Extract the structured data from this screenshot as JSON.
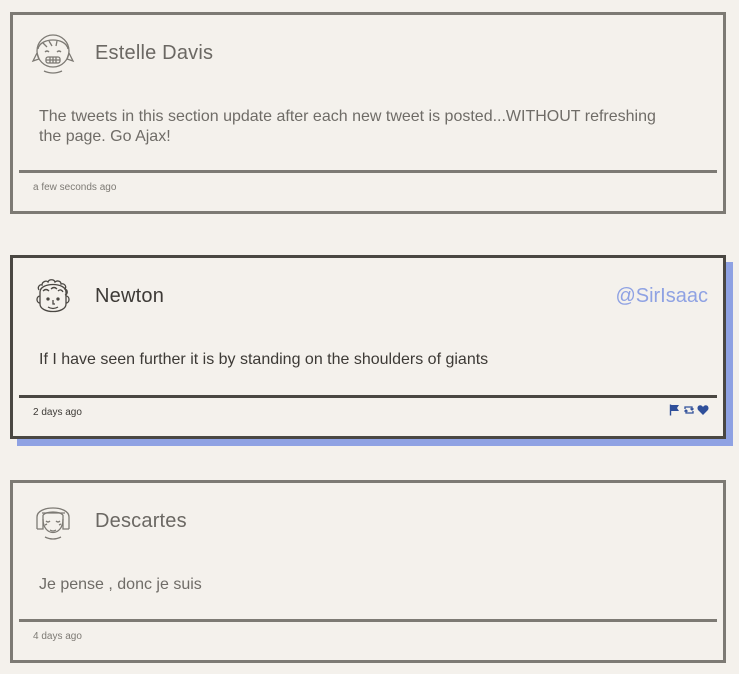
{
  "tweets": [
    {
      "user": "Estelle Davis",
      "handle": "",
      "content": "The tweets in this section update after each new tweet is posted...WITHOUT refreshing the page. Go Ajax!",
      "time": "a few seconds ago",
      "avatar_icon": "girl-pigtails-avatar-icon"
    },
    {
      "user": "Newton",
      "handle": "@SirIsaac",
      "content": "If I have seen further it is by standing on the shoulders of giants",
      "time": "2 days ago",
      "avatar_icon": "curly-hair-man-avatar-icon",
      "actions": [
        "flag-icon",
        "retweet-icon",
        "heart-icon"
      ]
    },
    {
      "user": "Descartes",
      "handle": "",
      "content": "Je pense , donc je suis",
      "time": "4 days ago",
      "avatar_icon": "bob-hair-avatar-icon"
    }
  ],
  "colors": {
    "background": "#f4f1ec",
    "border": "#7d7a74",
    "hover_border": "#4a4742",
    "accent": "#8fa2e3",
    "action_icon": "#2f4f9a"
  }
}
